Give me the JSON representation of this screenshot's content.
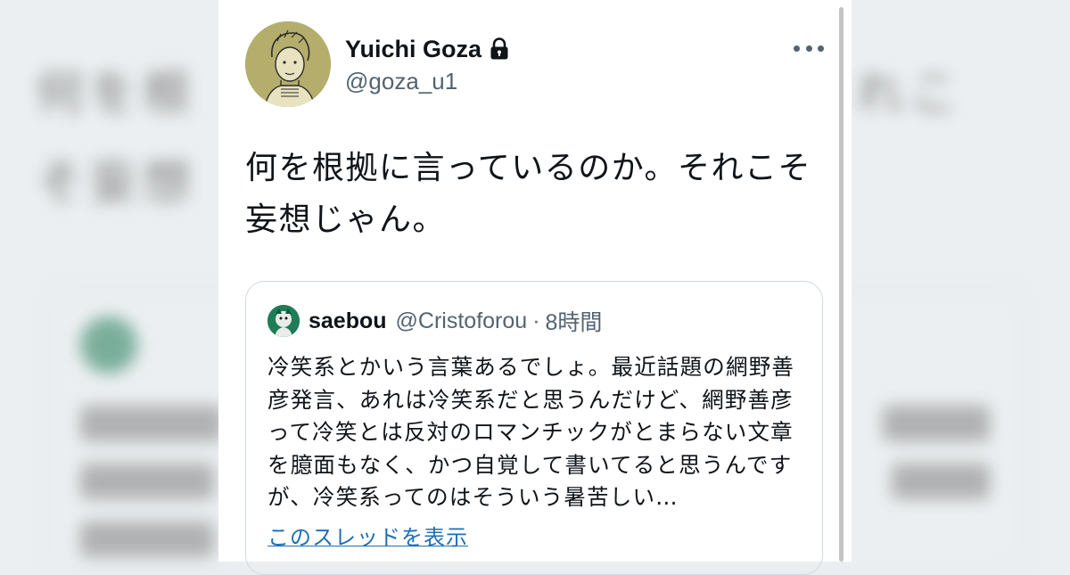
{
  "tweet": {
    "author_name": "Yuichi Goza",
    "author_handle": "@goza_u1",
    "protected_icon": "lock-icon",
    "menu_icon": "more-horizontal-icon",
    "text": "何を根拠に言っているのか。それこそ妄想じゃん。"
  },
  "quoted_tweet": {
    "author_name": "saebou",
    "author_handle": "@Cristoforou",
    "separator": "·",
    "time": "8時間",
    "text": "冷笑系とかいう言葉あるでしょ。最近話題の網野善彦発言、あれは冷笑系だと思うんだけど、網野善彦って冷笑とは反対のロマンチックがとまらない文章を臆面もなく、かつ自覚して書いてると思うんですが、冷笑系ってのはそういう暑苦しい…",
    "show_thread_label": "このスレッドを表示"
  },
  "colors": {
    "text_primary": "#0f1419",
    "text_secondary": "#536471",
    "link": "#1d6fb8",
    "border": "#cfd9de",
    "avatar_bg": "#b5ad6c",
    "quoted_avatar_bg": "#1e7d57"
  }
}
